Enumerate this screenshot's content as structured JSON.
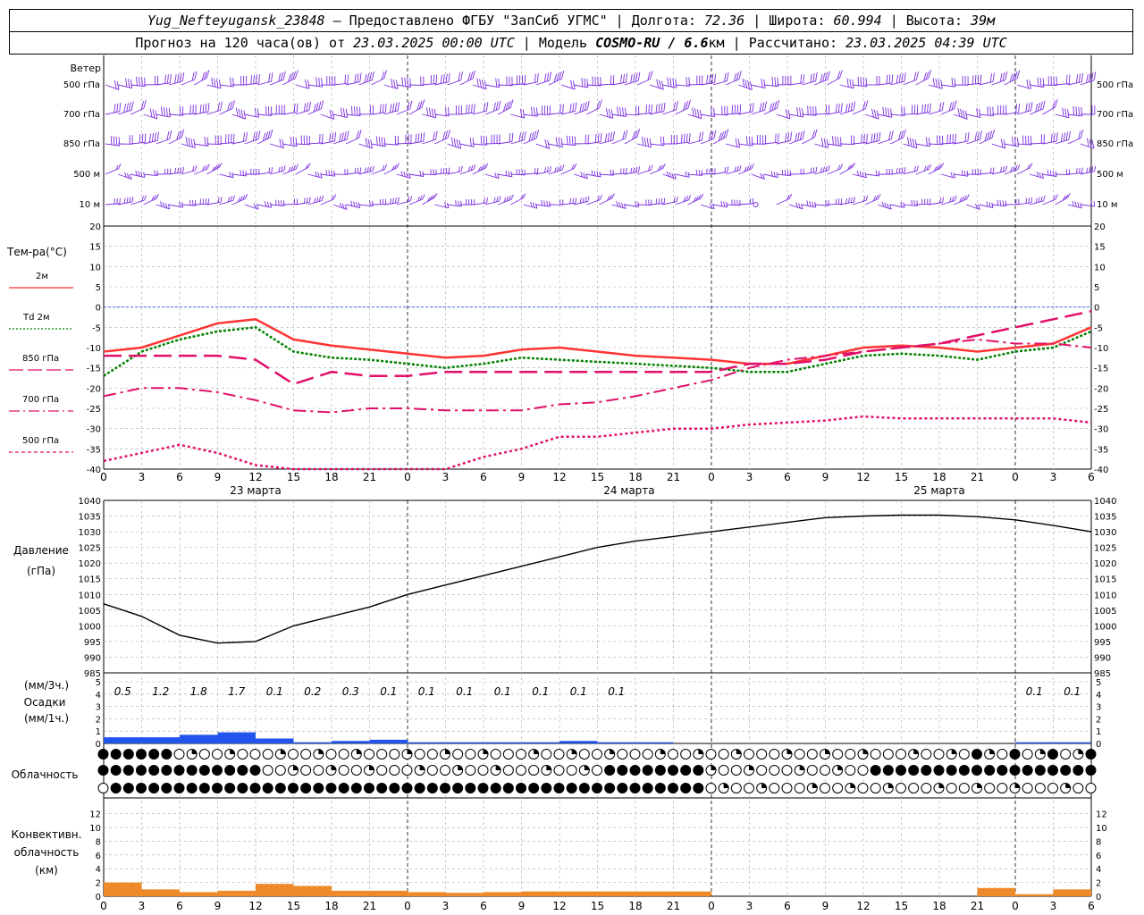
{
  "header": {
    "station": "Yug_Nefteyugansk_23848",
    "provided_prefix": "– Предоставлено ФГБУ",
    "provider": "\"ЗапСиб УГМС\"",
    "lon_label": "Долгота:",
    "lon_value": "72.36",
    "lat_label": "Широта:",
    "lat_value": "60.994",
    "alt_label": "Высота:",
    "alt_value": "39м",
    "forecast_prefix": "Прогноз на 120 часа(ов) от",
    "forecast_date": "23.03.2025 00:00 UTC",
    "model_label": "Модель",
    "model_name": "COSMO-RU / 6.6",
    "model_unit": "км",
    "calc_label": "Рассчитано:",
    "calc_date": "23.03.2025 04:39 UTC"
  },
  "x_axis": {
    "hour_ticks": [
      "0",
      "3",
      "6",
      "9",
      "12",
      "15",
      "18",
      "21",
      "0",
      "3",
      "6",
      "9",
      "12",
      "15",
      "18",
      "21",
      "0",
      "3",
      "6",
      "9",
      "12",
      "15",
      "18",
      "21",
      "0",
      "3",
      "6"
    ],
    "day_labels": [
      "23 марта",
      "24 марта",
      "25 марта"
    ]
  },
  "wind_panel": {
    "title": "Ветер",
    "levels": [
      "500 гПа",
      "700 гПа",
      "850 гПа",
      "500 м",
      "10 м"
    ]
  },
  "temp_panel": {
    "title": "Тем-ра(°C)",
    "legend": [
      {
        "label": "2м",
        "color": "#ff3333",
        "dash": "solid"
      },
      {
        "label": "Td  2м",
        "color": "#008000",
        "dash": "dot"
      },
      {
        "label": "850 гПа",
        "color": "#e0106a",
        "dash": "long"
      },
      {
        "label": "700 гПа",
        "color": "#e0106a",
        "dash": "dashdot"
      },
      {
        "label": "500 гПа",
        "color": "#e0106a",
        "dash": "short"
      }
    ],
    "yticks": [
      "20",
      "15",
      "10",
      "5",
      "0",
      "-5",
      "-10",
      "-15",
      "-20",
      "-25",
      "-30",
      "-35",
      "-40"
    ]
  },
  "pressure_panel": {
    "title": "Давление",
    "unit": "(гПа)",
    "yticks": [
      "1040",
      "1035",
      "1030",
      "1025",
      "1020",
      "1015",
      "1010",
      "1005",
      "1000",
      "995",
      "990",
      "985"
    ]
  },
  "precip_panel": {
    "unit3": "(мм/3ч.)",
    "title": "Осадки",
    "unit1": "(мм/1ч.)",
    "yticks": [
      "5",
      "4",
      "3",
      "2",
      "1",
      "0"
    ],
    "labels": [
      "0.5",
      "1.2",
      "1.8",
      "1.7",
      "0.1",
      "0.2",
      "0.3",
      "0.1",
      "0.1",
      "0.1",
      "0.1",
      "0.1",
      "0.1",
      "0.1",
      "0.1",
      "0.1"
    ]
  },
  "cloud_panel": {
    "title": "Облачность"
  },
  "conv_panel": {
    "title1": "Конвективн.",
    "title2": "облачность",
    "unit": "(км)",
    "yticks": [
      "12",
      "10",
      "8",
      "6",
      "4",
      "2",
      "0"
    ]
  },
  "chart_data": {
    "type": "line",
    "x_hours": [
      0,
      3,
      6,
      9,
      12,
      15,
      18,
      21,
      24,
      27,
      30,
      33,
      36,
      39,
      42,
      45,
      48,
      51,
      54,
      57,
      60,
      63,
      66,
      69,
      72,
      75,
      78
    ],
    "series": [
      {
        "name": "2м",
        "values": [
          -11,
          -10,
          -7,
          -4,
          -3,
          -8,
          -9.5,
          -10.5,
          -11.5,
          -12.5,
          -12,
          -10.5,
          -10,
          -11,
          -12,
          -12.5,
          -13,
          -14,
          -14,
          -12,
          -10,
          -9.5,
          -10,
          -11,
          -10,
          -9,
          -5
        ]
      },
      {
        "name": "Td 2м",
        "values": [
          -17,
          -11,
          -8,
          -6,
          -5,
          -11,
          -12.5,
          -13,
          -14,
          -15,
          -14,
          -12.5,
          -13,
          -13.5,
          -14,
          -14.5,
          -15,
          -16,
          -16,
          -14,
          -12,
          -11.5,
          -12,
          -13,
          -11,
          -10,
          -6
        ]
      },
      {
        "name": "850 гПа",
        "values": [
          -12,
          -12,
          -12,
          -12,
          -13,
          -19,
          -16,
          -17,
          -17,
          -16,
          -16,
          -16,
          -16,
          -16,
          -16,
          -16,
          -16,
          -14,
          -14,
          -13,
          -11,
          -10,
          -9,
          -7,
          -5,
          -3,
          -1
        ]
      },
      {
        "name": "700 гПа",
        "values": [
          -22,
          -20,
          -20,
          -21,
          -23,
          -25.5,
          -26,
          -25,
          -25,
          -25.5,
          -25.5,
          -25.5,
          -24,
          -23.5,
          -22,
          -20,
          -18,
          -15,
          -13,
          -12,
          -11,
          -10,
          -9,
          -8,
          -9,
          -9,
          -10
        ]
      },
      {
        "name": "500 гПа",
        "values": [
          -38,
          -36,
          -34,
          -36,
          -39,
          -40,
          -43,
          -45,
          -45,
          -40,
          -37,
          -35,
          -32,
          -32,
          -31,
          -30,
          -30,
          -29,
          -28.5,
          -28,
          -27,
          -27.5,
          -27.5,
          -27.5,
          -27.5,
          -27.5,
          -28.5
        ]
      },
      {
        "name": "Давление",
        "values": [
          1007,
          1003,
          997,
          994.5,
          995,
          1000,
          1003,
          1006,
          1010,
          1013,
          1016,
          1019,
          1022,
          1025,
          1027,
          1028.5,
          1030,
          1031.5,
          1033,
          1034.5,
          1035,
          1035.3,
          1035.3,
          1034.8,
          1033.8,
          1032,
          1030
        ]
      }
    ],
    "precip_bars": [
      0.5,
      0.5,
      0.7,
      0.9,
      0.4,
      0.1,
      0.2,
      0.3,
      0.1,
      0.1,
      0.1,
      0.1,
      0.2,
      0.1,
      0.1,
      0,
      0,
      0,
      0,
      0,
      0,
      0,
      0,
      0,
      0.1,
      0.1,
      0
    ],
    "conv_cloud_km": [
      2,
      1,
      0.6,
      0.8,
      1.8,
      1.5,
      0.8,
      0.8,
      0.6,
      0.5,
      0.6,
      0.7,
      0.7,
      0.7,
      0.7,
      0.7,
      0,
      0,
      0,
      0,
      0,
      0,
      0,
      1.2,
      0.3,
      1,
      1
    ],
    "ylim_temp": [
      -40,
      20
    ],
    "ylim_pressure": [
      985,
      1040
    ]
  }
}
